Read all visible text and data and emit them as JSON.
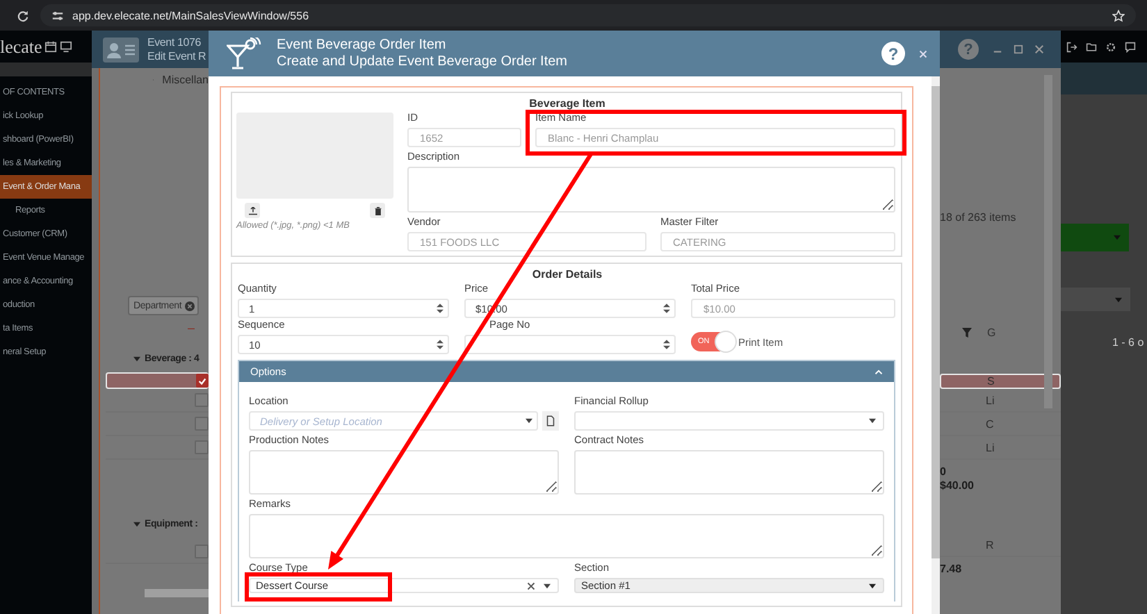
{
  "browser": {
    "url": "app.dev.elecate.net/MainSalesViewWindow/556"
  },
  "sidebar": {
    "logo": "lecate",
    "items": [
      {
        "label": "OF CONTENTS",
        "selected": false
      },
      {
        "label": "ick Lookup",
        "selected": false
      },
      {
        "label": "shboard (PowerBI)",
        "selected": false
      },
      {
        "label": "les & Marketing",
        "selected": false
      },
      {
        "label": "Event & Order Mana",
        "selected": true,
        "children": [
          {
            "label": "Reports",
            "selected": false
          }
        ]
      },
      {
        "label": "Customer (CRM)",
        "selected": false
      },
      {
        "label": "Event Venue Manage",
        "selected": false
      },
      {
        "label": "ance & Accounting",
        "selected": false
      },
      {
        "label": "oduction",
        "selected": false
      },
      {
        "label": "ta Items",
        "selected": false
      },
      {
        "label": "neral Setup",
        "selected": false
      }
    ]
  },
  "back_window": {
    "title": "Event 1076",
    "subtitle": "Edit Event R",
    "help": "?",
    "tree_item": "Miscellan",
    "filter_chip": "Department",
    "collapse_sign": "–",
    "item_count": "18 of 263 items",
    "column_heading": "G",
    "pager": "1 - 6 o",
    "groups": [
      {
        "label": "Beverage : 4",
        "rows": [
          {
            "selected": true,
            "checked": true,
            "cell": "S"
          },
          {
            "selected": false,
            "checked": false,
            "cell": "Li"
          },
          {
            "selected": false,
            "checked": false,
            "cell": "C"
          },
          {
            "selected": false,
            "checked": false,
            "cell": "Li"
          }
        ],
        "totals": [
          "0",
          "$40.00"
        ]
      },
      {
        "label": "Equipment :",
        "rows": [
          {
            "selected": false,
            "checked": false,
            "cell": "R"
          }
        ],
        "totals": [
          "7.48"
        ]
      }
    ]
  },
  "dialog": {
    "title": "Event Beverage Order Item",
    "subtitle": "Create and Update Event Beverage Order Item",
    "help": "?",
    "beverage_item": {
      "heading": "Beverage Item",
      "image_hint": "Allowed (*.jpg, *.png) <1 MB",
      "id": {
        "label": "ID",
        "value": "1652"
      },
      "item_name": {
        "label": "Item Name",
        "value": "Blanc - Henri Champlau"
      },
      "description": {
        "label": "Description"
      },
      "vendor": {
        "label": "Vendor",
        "value": "151 FOODS LLC"
      },
      "master_filter": {
        "label": "Master Filter",
        "value": "CATERING"
      }
    },
    "order_details": {
      "heading": "Order Details",
      "quantity": {
        "label": "Quantity",
        "value": "1"
      },
      "price": {
        "label": "Price",
        "value": "$10.00"
      },
      "total_price": {
        "label": "Total Price",
        "value": "$10.00"
      },
      "sequence": {
        "label": "Sequence",
        "value": "10"
      },
      "page_no": {
        "label": "Page No"
      },
      "print_item": {
        "label": "Print Item",
        "toggle_text": "ON",
        "on": true
      }
    },
    "options": {
      "title": "Options",
      "expanded": true,
      "location": {
        "label": "Location",
        "placeholder": "Delivery or Setup Location"
      },
      "financial_rollup": {
        "label": "Financial Rollup"
      },
      "production_notes": {
        "label": "Production Notes"
      },
      "contract_notes": {
        "label": "Contract Notes"
      },
      "remarks": {
        "label": "Remarks"
      },
      "course_type": {
        "label": "Course Type",
        "value": "Dessert Course"
      },
      "section": {
        "label": "Section",
        "value": "Section #1"
      }
    }
  }
}
